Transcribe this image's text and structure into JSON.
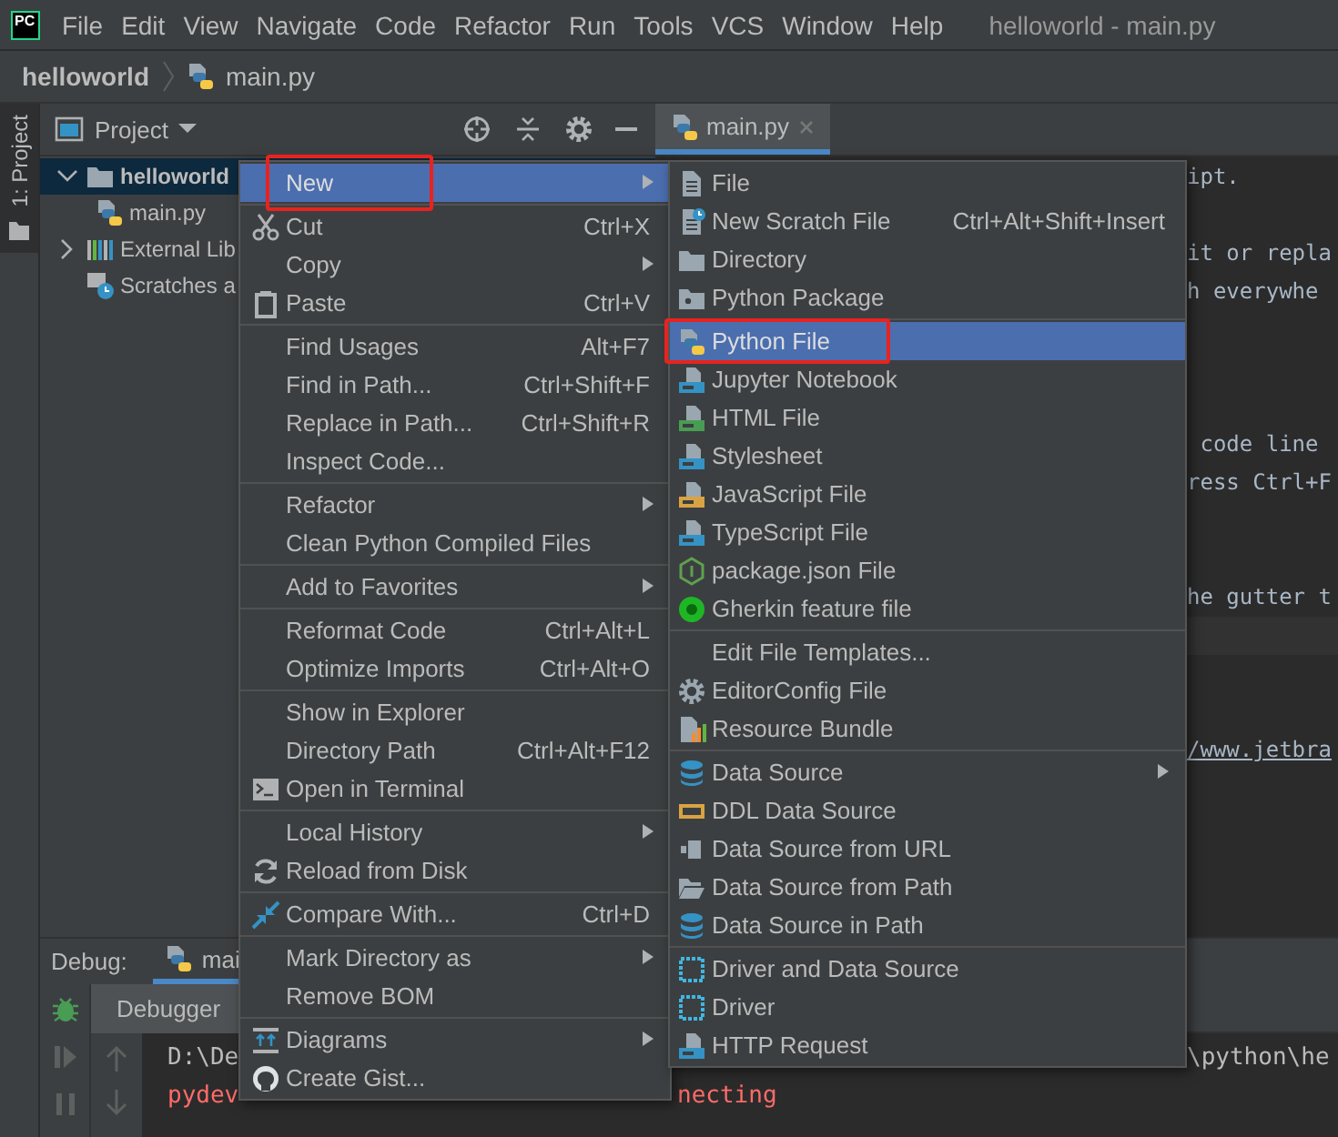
{
  "logo": "PC",
  "menu_bar": [
    "File",
    "Edit",
    "View",
    "Navigate",
    "Code",
    "Refactor",
    "Run",
    "Tools",
    "VCS",
    "Window",
    "Help"
  ],
  "window": {
    "title": "helloworld - main.py"
  },
  "breadcrumb": [
    "helloworld",
    "main.py"
  ],
  "tool_strip": {
    "label": "1: Project",
    "selected": true
  },
  "project_panel": {
    "title": "Project",
    "tree": [
      {
        "label": "helloworld",
        "selected": true,
        "expanded": true,
        "children": [
          {
            "label": "main.py",
            "selected": false
          }
        ]
      },
      {
        "label": "External Lib",
        "selected": false,
        "expanded": false
      },
      {
        "label": "Scratches a",
        "selected": false
      }
    ]
  },
  "editor": {
    "tabs": [
      {
        "label": "main.py",
        "selected": true
      }
    ],
    "lines": [
      {
        "kind": "text",
        "text": "ipt.",
        "current": false
      },
      {
        "kind": "blank",
        "current": false
      },
      {
        "kind": "text",
        "text": "it or repla",
        "current": false
      },
      {
        "kind": "text",
        "text": "h everywhe",
        "current": false
      },
      {
        "kind": "blank",
        "current": false
      },
      {
        "kind": "blank",
        "current": false
      },
      {
        "kind": "blank",
        "current": false
      },
      {
        "kind": "text",
        "text": " code line",
        "current": false
      },
      {
        "kind": "text",
        "text": "ress Ctrl+F",
        "current": false
      },
      {
        "kind": "blank",
        "current": false
      },
      {
        "kind": "blank",
        "current": false
      },
      {
        "kind": "text",
        "text": "he gutter t",
        "current": false
      },
      {
        "kind": "blank",
        "current": true
      },
      {
        "kind": "blank",
        "current": false
      },
      {
        "kind": "blank",
        "current": false
      },
      {
        "kind": "link",
        "text": "/www.jetbra",
        "current": false
      }
    ]
  },
  "debug": {
    "label": "Debug:",
    "tabs": [
      {
        "label": "mai",
        "selected": true
      }
    ],
    "sub_tabs": [
      {
        "label": "Debugger",
        "selected": true
      }
    ],
    "console": [
      {
        "kind": "output",
        "left": "D:\\De",
        "right": "\\python\\he"
      },
      {
        "kind": "error",
        "left": "pydev",
        "middle": "necting"
      }
    ]
  },
  "context_menu": {
    "groups": [
      {
        "items": [
          {
            "label": "New",
            "submenu": true,
            "selected": true,
            "annotated": true
          }
        ]
      },
      {
        "items": [
          {
            "label": "Cut",
            "shortcut": "Ctrl+X",
            "selected": false,
            "annotated": false
          },
          {
            "label": "Copy",
            "submenu": true,
            "selected": false,
            "annotated": false
          },
          {
            "label": "Paste",
            "shortcut": "Ctrl+V",
            "selected": false,
            "annotated": false
          }
        ]
      },
      {
        "items": [
          {
            "label": "Find Usages",
            "shortcut": "Alt+F7",
            "selected": false,
            "annotated": false
          },
          {
            "label": "Find in Path...",
            "shortcut": "Ctrl+Shift+F",
            "selected": false,
            "annotated": false
          },
          {
            "label": "Replace in Path...",
            "shortcut": "Ctrl+Shift+R",
            "selected": false,
            "annotated": false
          },
          {
            "label": "Inspect Code...",
            "selected": false,
            "annotated": false
          }
        ]
      },
      {
        "items": [
          {
            "label": "Refactor",
            "submenu": true,
            "selected": false,
            "annotated": false
          },
          {
            "label": "Clean Python Compiled Files",
            "selected": false,
            "annotated": false
          }
        ]
      },
      {
        "items": [
          {
            "label": "Add to Favorites",
            "submenu": true,
            "selected": false,
            "annotated": false
          }
        ]
      },
      {
        "items": [
          {
            "label": "Reformat Code",
            "shortcut": "Ctrl+Alt+L",
            "selected": false,
            "annotated": false
          },
          {
            "label": "Optimize Imports",
            "shortcut": "Ctrl+Alt+O",
            "selected": false,
            "annotated": false
          }
        ]
      },
      {
        "items": [
          {
            "label": "Show in Explorer",
            "selected": false,
            "annotated": false
          },
          {
            "label": "Directory Path",
            "shortcut": "Ctrl+Alt+F12",
            "selected": false,
            "annotated": false
          },
          {
            "label": "Open in Terminal",
            "selected": false,
            "annotated": false
          }
        ]
      },
      {
        "items": [
          {
            "label": "Local History",
            "submenu": true,
            "selected": false,
            "annotated": false
          },
          {
            "label": "Reload from Disk",
            "selected": false,
            "annotated": false
          }
        ]
      },
      {
        "items": [
          {
            "label": "Compare With...",
            "shortcut": "Ctrl+D",
            "selected": false,
            "annotated": false
          }
        ]
      },
      {
        "items": [
          {
            "label": "Mark Directory as",
            "submenu": true,
            "selected": false,
            "annotated": false
          },
          {
            "label": "Remove BOM",
            "selected": false,
            "annotated": false
          }
        ]
      },
      {
        "items": [
          {
            "label": "Diagrams",
            "submenu": true,
            "selected": false,
            "annotated": false
          },
          {
            "label": "Create Gist...",
            "selected": false,
            "annotated": false
          }
        ]
      }
    ]
  },
  "new_submenu": {
    "groups": [
      {
        "items": [
          {
            "label": "File",
            "selected": false,
            "annotated": false
          },
          {
            "label": "New Scratch File",
            "shortcut": "Ctrl+Alt+Shift+Insert",
            "selected": false,
            "annotated": false
          },
          {
            "label": "Directory",
            "selected": false,
            "annotated": false
          },
          {
            "label": "Python Package",
            "selected": false,
            "annotated": false
          }
        ]
      },
      {
        "items": [
          {
            "label": "Python File",
            "selected": true,
            "annotated": true
          },
          {
            "label": "Jupyter Notebook",
            "selected": false,
            "annotated": false
          },
          {
            "label": "HTML File",
            "selected": false,
            "annotated": false
          },
          {
            "label": "Stylesheet",
            "selected": false,
            "annotated": false
          },
          {
            "label": "JavaScript File",
            "selected": false,
            "annotated": false
          },
          {
            "label": "TypeScript File",
            "selected": false,
            "annotated": false
          },
          {
            "label": "package.json File",
            "selected": false,
            "annotated": false
          },
          {
            "label": "Gherkin feature file",
            "selected": false,
            "annotated": false
          }
        ]
      },
      {
        "items": [
          {
            "label": "Edit File Templates...",
            "selected": false,
            "annotated": false
          },
          {
            "label": "EditorConfig File",
            "selected": false,
            "annotated": false
          },
          {
            "label": "Resource Bundle",
            "selected": false,
            "annotated": false
          }
        ]
      },
      {
        "items": [
          {
            "label": "Data Source",
            "submenu": true,
            "selected": false,
            "annotated": false
          },
          {
            "label": "DDL Data Source",
            "selected": false,
            "annotated": false
          },
          {
            "label": "Data Source from URL",
            "selected": false,
            "annotated": false
          },
          {
            "label": "Data Source from Path",
            "selected": false,
            "annotated": false
          },
          {
            "label": "Data Source in Path",
            "selected": false,
            "annotated": false
          }
        ]
      },
      {
        "items": [
          {
            "label": "Driver and Data Source",
            "selected": false,
            "annotated": false
          },
          {
            "label": "Driver",
            "selected": false,
            "annotated": false
          },
          {
            "label": "HTTP Request",
            "selected": false,
            "annotated": false
          }
        ]
      }
    ]
  }
}
